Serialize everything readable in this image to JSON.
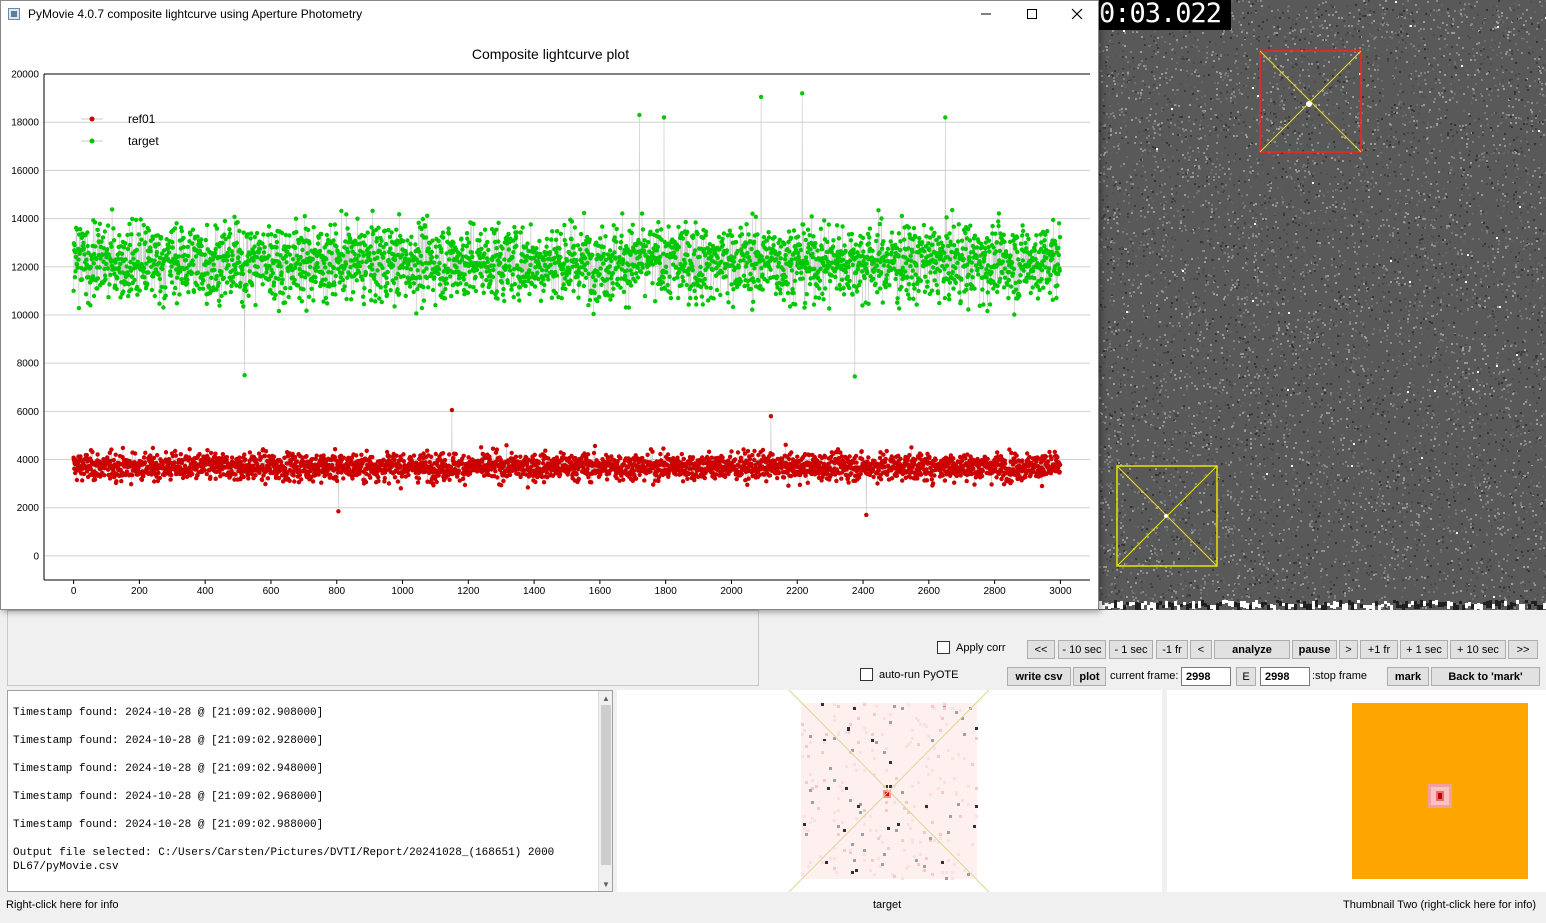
{
  "window": {
    "title": "PyMovie 4.0.7 composite lightcurve using Aperture Photometry",
    "minimize_icon": "minimize-icon",
    "maximize_icon": "maximize-icon",
    "close_icon": "close-icon"
  },
  "video": {
    "timestamp_fragment": "0:03.022"
  },
  "chart_data": {
    "type": "scatter",
    "title": "Composite lightcurve plot",
    "xlabel": "",
    "ylabel": "",
    "xlim": [
      -90,
      3090
    ],
    "ylim": [
      -1000,
      20000
    ],
    "x_ticks": [
      0,
      200,
      400,
      600,
      800,
      1000,
      1200,
      1400,
      1600,
      1800,
      2000,
      2200,
      2400,
      2600,
      2800,
      3000
    ],
    "y_ticks": [
      0,
      2000,
      4000,
      6000,
      8000,
      10000,
      12000,
      14000,
      16000,
      18000,
      20000
    ],
    "grid": "horizontal",
    "legend_position": "top-left",
    "n_points_per_series": 3000,
    "series": [
      {
        "name": "ref01",
        "color": "#cc0000",
        "mean": 3700,
        "spread": 500,
        "min": 1700,
        "max": 6050,
        "notable_points": [
          [
            1150,
            6050
          ],
          [
            2120,
            5800
          ],
          [
            2410,
            1700
          ],
          [
            805,
            1850
          ]
        ]
      },
      {
        "name": "target",
        "color": "#00c800",
        "mean": 12200,
        "spread": 1400,
        "min": 7450,
        "max": 19200,
        "notable_points": [
          [
            2090,
            19050
          ],
          [
            2215,
            19200
          ],
          [
            1720,
            18300
          ],
          [
            1795,
            18200
          ],
          [
            2650,
            18200
          ],
          [
            520,
            7500
          ],
          [
            2375,
            7450
          ]
        ]
      }
    ]
  },
  "controls": {
    "apply_corr_label": "Apply corr",
    "auto_run_label": "auto-run PyOTE",
    "nav_buttons": [
      "<<",
      "- 10 sec",
      "- 1 sec",
      "-1 fr",
      "<",
      "analyze",
      "pause",
      ">",
      "+1 fr",
      "+ 1 sec",
      "+ 10 sec",
      ">>"
    ],
    "write_csv_label": "write csv",
    "plot_label": "plot",
    "current_frame_label": "current frame:",
    "current_frame_value": "2998",
    "e_label": "E",
    "stop_frame_value": "2998",
    "stop_frame_label": ":stop frame",
    "mark_label": "mark",
    "back_to_mark_label": "Back to 'mark'"
  },
  "log": {
    "lines": [
      "Timestamp found: 2024-10-28 @ [21:09:02.908000]",
      "Timestamp found: 2024-10-28 @ [21:09:02.928000]",
      "Timestamp found: 2024-10-28 @ [21:09:02.948000]",
      "Timestamp found: 2024-10-28 @ [21:09:02.968000]",
      "Timestamp found: 2024-10-28 @ [21:09:02.988000]",
      "Output file selected: C:/Users/Carsten/Pictures/DVTI/Report/20241028_(168651) 2000 DL67/pyMovie.csv"
    ]
  },
  "status": {
    "left": "Right-click here for info",
    "center": "target",
    "right": "Thumbnail Two (right-click here for info)"
  },
  "colors": {
    "ref_aperture": "#ff2020",
    "target_aperture": "#e6e600",
    "thumbnail_two_bg": "#ffa500"
  }
}
